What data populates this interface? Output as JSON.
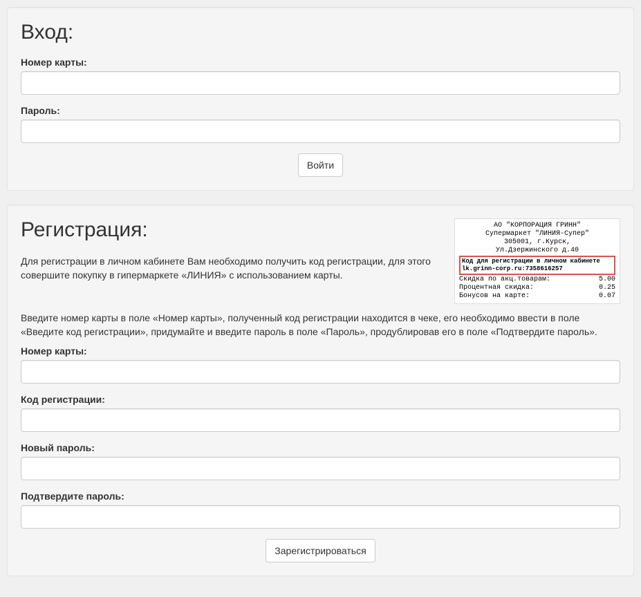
{
  "login": {
    "heading": "Вход:",
    "card_label": "Номер карты:",
    "password_label": "Пароль:",
    "submit_label": "Войти"
  },
  "register": {
    "heading": "Регистрация:",
    "instruction1": "Для регистрации в личном кабинете Вам необходимо получить код регистрации, для этого совершите покупку в гипермаркете «ЛИНИЯ» с использованием карты.",
    "instruction2": "Введите номер карты в поле «Номер карты», полученный код регистрации находится в чеке, его необходимо ввести в поле «Введите код регистрации», придумайте и введите пароль в поле «Пароль», продублировав его в поле «Подтвердите пароль».",
    "card_label": "Номер карты:",
    "code_label": "Код регистрации:",
    "new_password_label": "Новый пароль:",
    "confirm_password_label": "Подтвердите пароль:",
    "submit_label": "Зарегистрироваться"
  },
  "receipt": {
    "line1": "АО \"КОРПОРАЦИЯ ГРИНН\"",
    "line2": "Супермаркет \"ЛИНИЯ-Супер\"",
    "line3": "305001, г.Курск,",
    "line4": "Ул.Дзержинского д.40",
    "box_line1": "Код для регистрации в личном кабинете",
    "box_line2": "lk.grinn-corp.ru:7358616257",
    "row1_label": "Скидка по акц.товарам:",
    "row1_value": "5.00",
    "row2_label": "Процентная скидка:",
    "row2_value": "0.25",
    "row3_label": "Бонусов на карте:",
    "row3_value": "0.07"
  }
}
